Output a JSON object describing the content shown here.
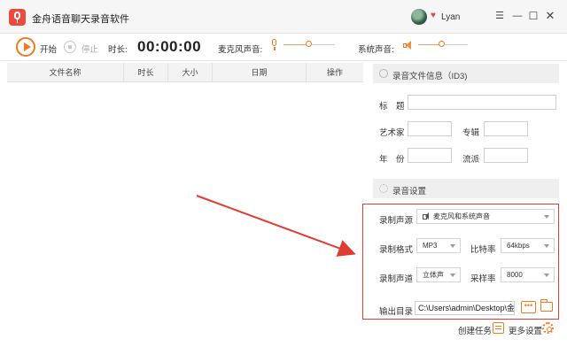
{
  "app": {
    "title": "金舟语音聊天录音软件",
    "user_name": "Lyan"
  },
  "toolbar": {
    "start_label": "开始",
    "stop_label": "停止",
    "duration_label": "时长:",
    "duration_value": "00:00:00",
    "mic_label": "麦克风声音:",
    "mic_level": 0.5,
    "system_label": "系统声音:",
    "system_level": 0.45
  },
  "table": {
    "columns": [
      "文件名称",
      "时长",
      "大小",
      "日期",
      "操作"
    ],
    "rows": []
  },
  "id3": {
    "section_title": "录音文件信息（ID3)",
    "title_label": "标　题",
    "title_value": "",
    "artist_label": "艺术家",
    "artist_value": "",
    "album_label": "专辑",
    "album_value": "",
    "year_label": "年　份",
    "year_value": "",
    "genre_label": "流派",
    "genre_value": ""
  },
  "settings": {
    "section_title": "录音设置",
    "source_label": "录制声源",
    "source_value": "麦克风和系统声音",
    "format_label": "录制格式",
    "format_value": "MP3",
    "bitrate_label": "比特率",
    "bitrate_value": "64kbps",
    "channel_label": "录制声道",
    "channel_value": "立体声",
    "samplerate_label": "采样率",
    "samplerate_value": "8000",
    "output_label": "输出目录",
    "output_value": "C:\\Users\\admin\\Desktop\\金"
  },
  "footer": {
    "create_task": "创建任务",
    "more_settings": "更多设置"
  },
  "colors": {
    "accent": "#f07a22",
    "highlight": "#e03c33"
  }
}
